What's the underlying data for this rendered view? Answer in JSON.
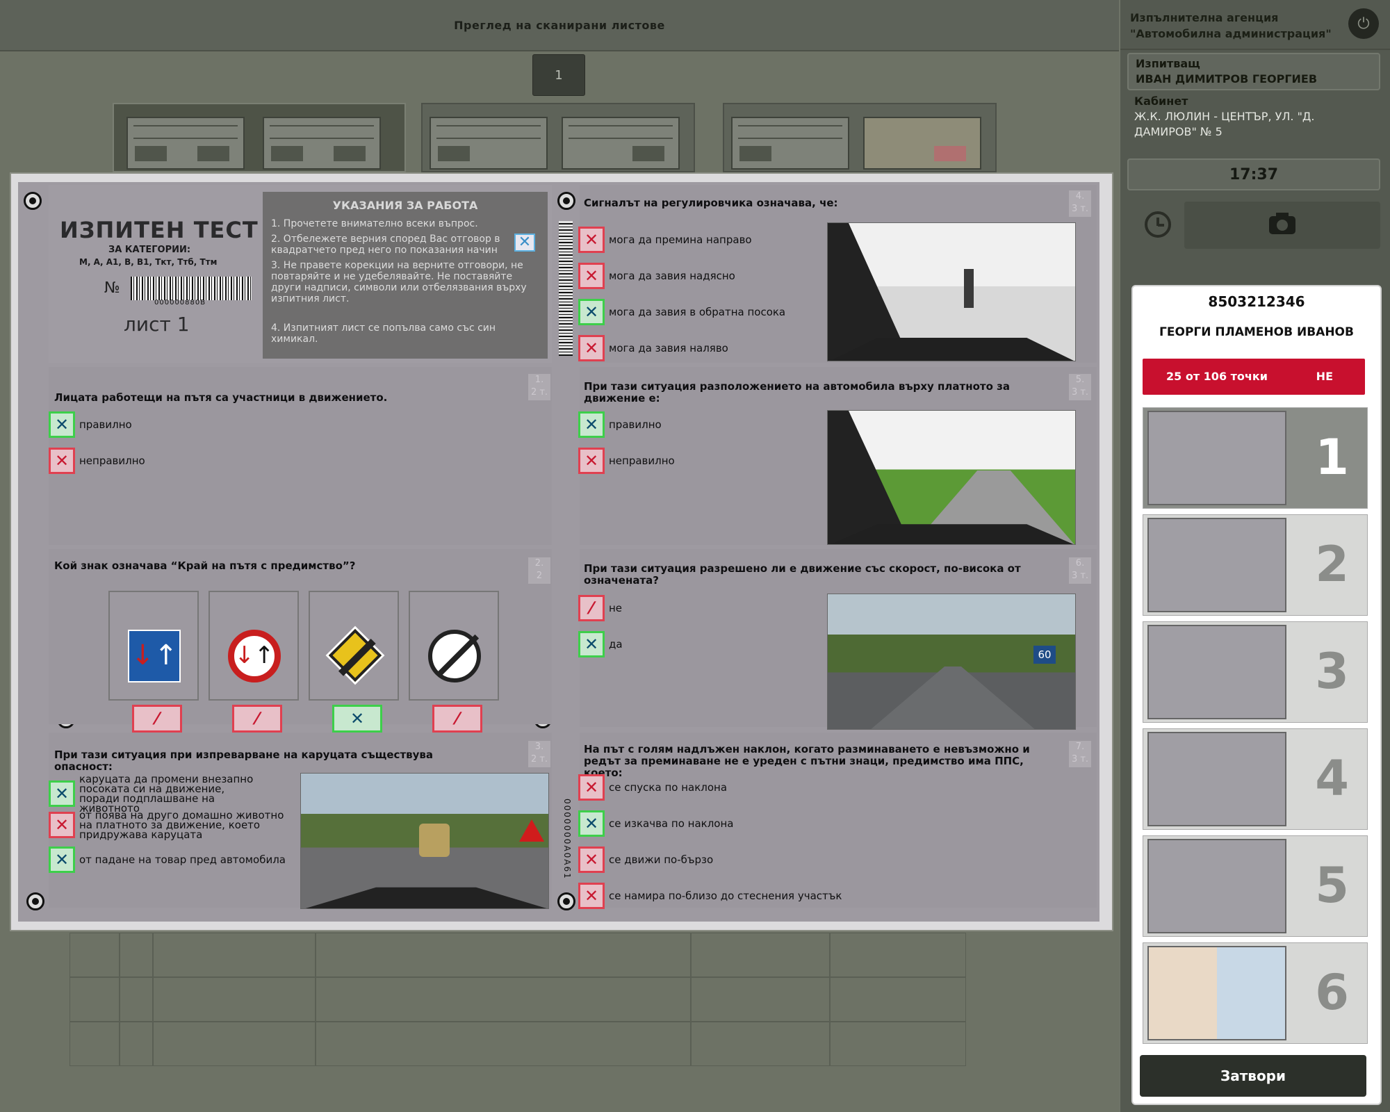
{
  "header": {
    "title": "Преглед на сканирани листове",
    "page_button": "1"
  },
  "agency": {
    "line1": "Изпълнителна агенция",
    "line2": "\"Автомобилна администрация\""
  },
  "examiner": {
    "label": "Изпитващ",
    "name": "ИВАН ДИМИТРОВ ГЕОРГИЕВ"
  },
  "cabinet": {
    "label": "Кабинет",
    "address": "Ж.К. ЛЮЛИН - ЦЕНТЪР, УЛ. \"Д. ДАМИРОВ\" № 5"
  },
  "time": "17:37",
  "candidate": {
    "id": "8503212346",
    "name": "ГЕОРГИ ПЛАМЕНОВ ИВАНОВ",
    "score": "25 от 106 точки",
    "result": "НЕ"
  },
  "sheets": [
    "1",
    "2",
    "3",
    "4",
    "5",
    "6"
  ],
  "close_button": "Затвори",
  "test": {
    "title": "ИЗПИТЕН ТЕСТ",
    "categories_label": "ЗА КАТЕГОРИИ:",
    "categories": "М, А, А1, В, В1, Ткт, Ттб, Ттм",
    "no_label": "№",
    "barcode_number": "000000880B",
    "side_code": "0000000A0A61",
    "sheet_label": "лист 1",
    "instructions_title": "УКАЗАНИЯ ЗА РАБОТА",
    "instructions": [
      "1. Прочетете внимателно всеки въпрос.",
      "2. Отбележете верния според Вас отговор в квадратчето пред него по показания начин",
      "3. Не правете корекции на верните отговори, не повтаряйте и не удебелявайте. Не поставяйте други надписи, символи или отбелязвания върху изпитния лист.",
      "4. Изпитният лист се попълва само със син химикал."
    ],
    "q1": {
      "num": "1.",
      "pts": "2 т.",
      "text": "Лицата работещи на пътя са участници в движението.",
      "options": [
        "правилно",
        "неправилно"
      ]
    },
    "q2": {
      "num": "2.",
      "pts": "2",
      "text": "Кой знак означава “Край на пътя с предимство”?"
    },
    "q3": {
      "num": "3.",
      "pts": "2 т.",
      "text": "При тази ситуация при изпреварване на каруцата съществува опасност:",
      "options": [
        "каруцата да промени внезапно посоката си на движение, поради подплашване на животното",
        "от поява на друго домашно животно на платното за движение, което придружава каруцата",
        "от падане на товар пред автомобила"
      ]
    },
    "q4": {
      "num": "4.",
      "pts": "3 т.",
      "text": "Сигналът на регулировчика означава, че:",
      "options": [
        "мога да премина направо",
        "мога да завия надясно",
        "мога да завия в обратна посока",
        "мога да завия наляво"
      ]
    },
    "q5": {
      "num": "5.",
      "pts": "3 т.",
      "text": "При тази ситуация разположението на автомобила върху платното за движение е:",
      "options": [
        "правилно",
        "неправилно"
      ]
    },
    "q6": {
      "num": "6.",
      "pts": "3 т.",
      "text": "При тази ситуация разрешено ли е движение със скорост, по-висока от означената?",
      "options": [
        "не",
        "да"
      ],
      "speed_sign": "60"
    },
    "q7": {
      "num": "7.",
      "pts": "3 т.",
      "text": "На път с голям надлъжен наклон, когато разминаването е невъзможно и редът за преминаване не е уреден с пътни знаци, предимство има ППС, което:",
      "options": [
        "се спуска по наклона",
        "се изкачва по наклона",
        "се движи по-бързо",
        "се намира по-близо до стеснения участък"
      ]
    }
  },
  "colors": {
    "correct": "#3dcf4a",
    "wrong": "#e04050",
    "score_bar": "#c8102e"
  }
}
